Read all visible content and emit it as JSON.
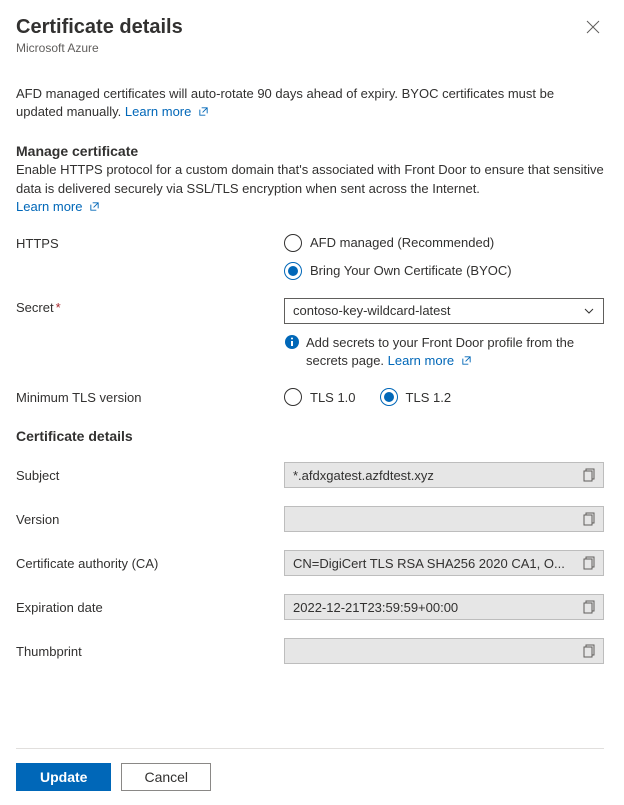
{
  "header": {
    "title": "Certificate details",
    "subtitle": "Microsoft Azure"
  },
  "intro": {
    "text": "AFD managed certificates will auto-rotate 90 days ahead of expiry. BYOC certificates must be updated manually. ",
    "learn_more": "Learn more"
  },
  "manage": {
    "heading": "Manage certificate",
    "desc": "Enable HTTPS protocol for a custom domain that's associated with Front Door to ensure that sensitive data is delivered securely via SSL/TLS encryption when sent across the Internet.",
    "learn_more": "Learn more"
  },
  "https": {
    "label": "HTTPS",
    "opt_managed": "AFD managed (Recommended)",
    "opt_byoc": "Bring Your Own Certificate (BYOC)"
  },
  "secret": {
    "label": "Secret",
    "value": "contoso-key-wildcard-latest",
    "info_text": "Add secrets to your Front Door profile from the secrets page. ",
    "learn_more": "Learn more"
  },
  "tls": {
    "label": "Minimum TLS version",
    "opt_10": "TLS 1.0",
    "opt_12": "TLS 1.2"
  },
  "details": {
    "heading": "Certificate details",
    "subject_label": "Subject",
    "subject_value": "*.afdxgatest.azfdtest.xyz",
    "version_label": "Version",
    "version_value": "",
    "ca_label": "Certificate authority (CA)",
    "ca_value": "CN=DigiCert TLS RSA SHA256 2020 CA1, O...",
    "exp_label": "Expiration date",
    "exp_value": "2022-12-21T23:59:59+00:00",
    "thumb_label": "Thumbprint",
    "thumb_value": ""
  },
  "footer": {
    "update": "Update",
    "cancel": "Cancel"
  }
}
